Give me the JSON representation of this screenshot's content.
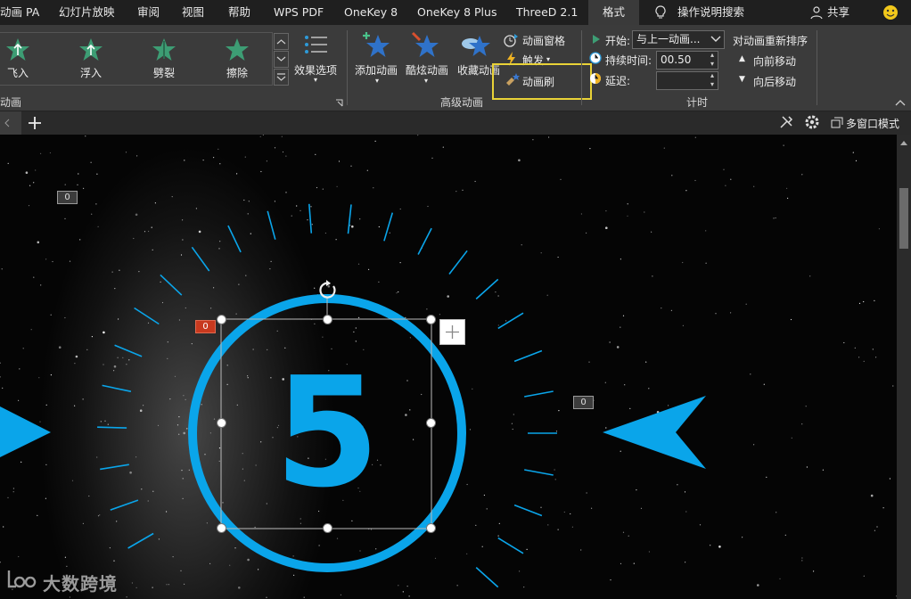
{
  "tabs": [
    {
      "label": "动画 PA"
    },
    {
      "label": "幻灯片放映"
    },
    {
      "label": "审阅"
    },
    {
      "label": "视图"
    },
    {
      "label": "帮助"
    },
    {
      "label": "WPS PDF"
    },
    {
      "label": "OneKey 8"
    },
    {
      "label": "OneKey 8 Plus"
    },
    {
      "label": "ThreeD 2.1"
    },
    {
      "label": "格式"
    }
  ],
  "search_label": "操作说明搜索",
  "share_label": "共享",
  "animations": [
    {
      "label": "飞入"
    },
    {
      "label": "浮入"
    },
    {
      "label": "劈裂"
    },
    {
      "label": "擦除"
    }
  ],
  "effect_options_label": "效果选项",
  "group_animation_label": "动画",
  "adv": {
    "add_label": "添加动画",
    "cool_label": "酷炫动画",
    "fav_label": "收藏动画",
    "pane_label": "动画窗格",
    "trigger_label": "触发",
    "brush_label": "动画刷",
    "group_label": "高级动画"
  },
  "timing": {
    "start_label": "开始:",
    "start_value": "与上一动画...",
    "duration_label": "持续时间:",
    "duration_value": "00.50",
    "delay_label": "延迟:",
    "delay_value": "",
    "reorder_label": "对动画重新排序",
    "move_earlier": "向前移动",
    "move_later": "向后移动",
    "group_label": "计时"
  },
  "multiwindow_label": "多窗口模式",
  "slide": {
    "number": "5",
    "badges": [
      "0",
      "0",
      "0"
    ],
    "watermark": "大数跨境"
  },
  "colors": {
    "accent": "#0aa5ea",
    "highlight": "#e9d237",
    "badge_red": "#c8391e"
  }
}
